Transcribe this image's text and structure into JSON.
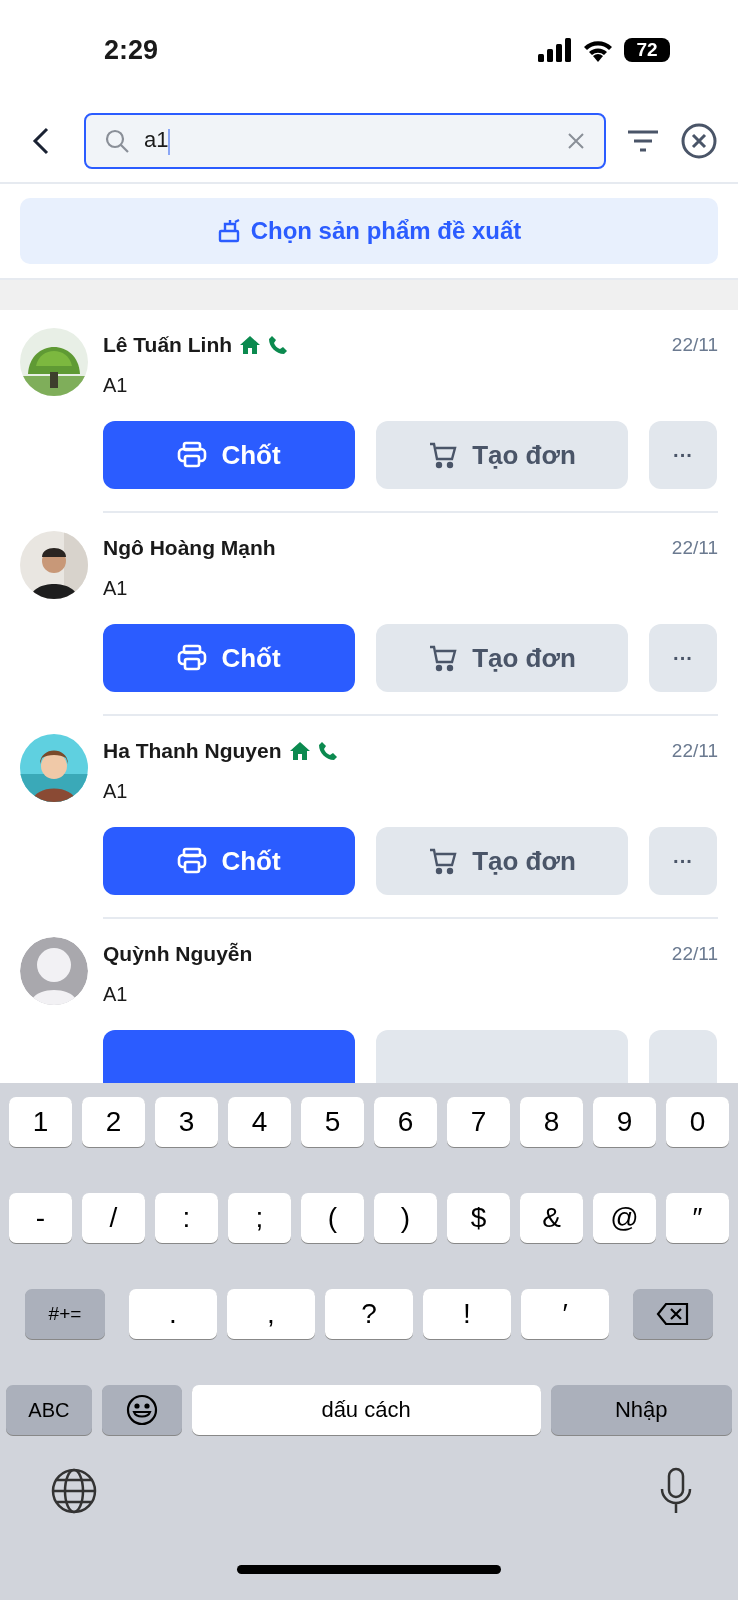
{
  "status_bar": {
    "time": "2:29",
    "battery": "72"
  },
  "search": {
    "value": "a1"
  },
  "suggest_button": {
    "label": "Chọn sản phẩm đề xuất"
  },
  "rows": [
    {
      "name": "Lê Tuấn Linh",
      "home": true,
      "phone": true,
      "date": "22/11",
      "note": "A1",
      "avatar": {
        "kind": "picture"
      },
      "buttons": [
        {
          "kind": "primary",
          "label": "Chốt"
        },
        {
          "kind": "secondary",
          "label": "Tạo đơn"
        },
        {
          "kind": "more",
          "label": "···"
        }
      ]
    },
    {
      "name": "Ngô Hoàng Mạnh",
      "home": false,
      "phone": false,
      "date": "22/11",
      "note": "A1",
      "avatar": {
        "kind": "picture"
      },
      "buttons": [
        {
          "kind": "primary",
          "label": "Chốt"
        },
        {
          "kind": "secondary",
          "label": "Tạo đơn"
        },
        {
          "kind": "more",
          "label": "···"
        }
      ]
    },
    {
      "name": "Ha Thanh Nguyen",
      "home": true,
      "phone": true,
      "date": "22/11",
      "note": "A1",
      "avatar": {
        "kind": "picture"
      },
      "buttons": [
        {
          "kind": "primary",
          "label": "Chốt"
        },
        {
          "kind": "secondary",
          "label": "Tạo đơn"
        },
        {
          "kind": "more",
          "label": "···"
        }
      ]
    },
    {
      "name": "Quỳnh Nguyễn",
      "home": false,
      "phone": false,
      "date": "22/11",
      "note": "A1",
      "avatar": {
        "kind": "placeholder"
      },
      "buttons": [
        {
          "kind": "primary"
        },
        {
          "kind": "secondary"
        },
        {
          "kind": "more"
        }
      ]
    }
  ],
  "keyboard": {
    "number_row": [
      {
        "kind": "char",
        "label": "1"
      },
      {
        "kind": "char",
        "label": "2"
      },
      {
        "kind": "char",
        "label": "3"
      },
      {
        "kind": "char",
        "label": "4"
      },
      {
        "kind": "char",
        "label": "5"
      },
      {
        "kind": "char",
        "label": "6"
      },
      {
        "kind": "char",
        "label": "7"
      },
      {
        "kind": "char",
        "label": "8"
      },
      {
        "kind": "char",
        "label": "9"
      },
      {
        "kind": "char",
        "label": "0"
      }
    ],
    "symbol_row": [
      {
        "kind": "char",
        "label": "-"
      },
      {
        "kind": "char",
        "label": "/"
      },
      {
        "kind": "char",
        "label": ":"
      },
      {
        "kind": "char",
        "label": ";"
      },
      {
        "kind": "char",
        "label": "("
      },
      {
        "kind": "char",
        "label": ")"
      },
      {
        "kind": "char",
        "label": "$"
      },
      {
        "kind": "char",
        "label": "&"
      },
      {
        "kind": "char",
        "label": "@"
      },
      {
        "kind": "char",
        "label": "″"
      }
    ],
    "punctuation_row": [
      {
        "kind": "func",
        "label": "#+="
      },
      {
        "kind": "wide",
        "label": "."
      },
      {
        "kind": "wide",
        "label": ","
      },
      {
        "kind": "wide",
        "label": "?"
      },
      {
        "kind": "wide",
        "label": "!"
      },
      {
        "kind": "wide",
        "label": "′"
      },
      {
        "kind": "backspace"
      }
    ],
    "bottom_row": [
      {
        "kind": "abc",
        "label": "ABC"
      },
      {
        "kind": "emoji"
      },
      {
        "kind": "space",
        "label": "dấu cách"
      },
      {
        "kind": "enter",
        "label": "Nhập"
      }
    ]
  }
}
